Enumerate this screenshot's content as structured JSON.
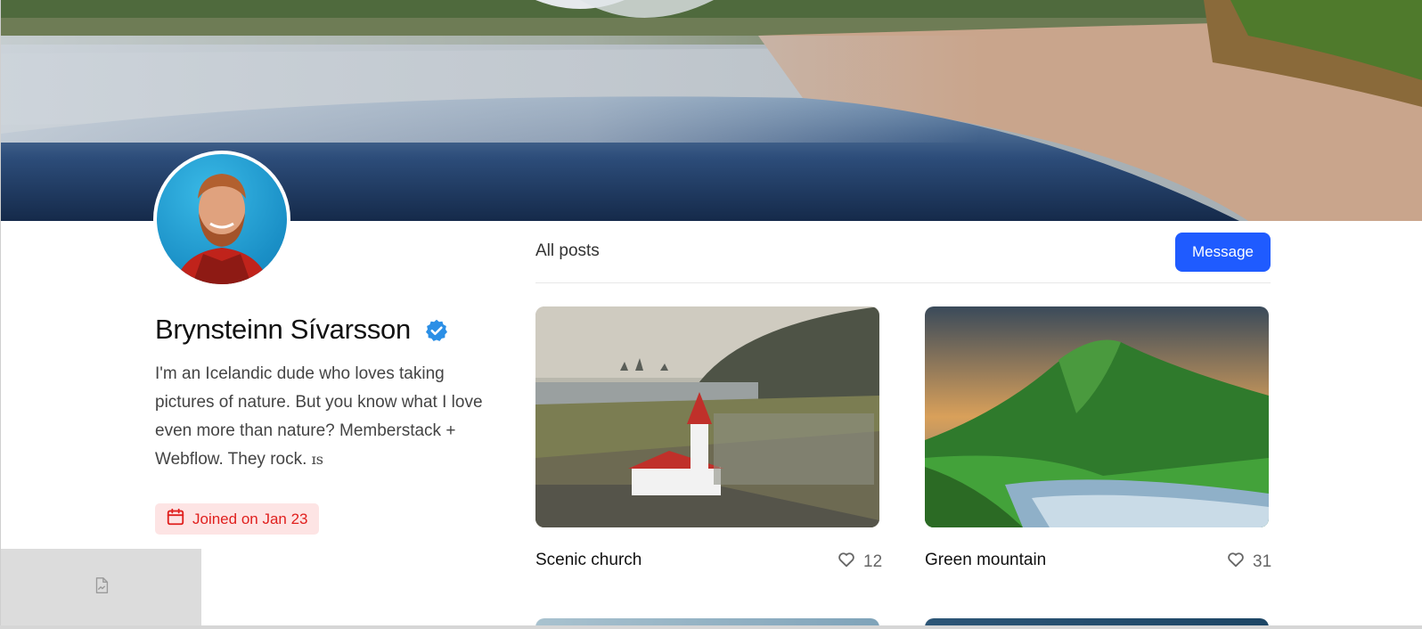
{
  "profile": {
    "name": "Brynsteinn Sívarsson",
    "bio": "I'm an Icelandic dude who loves taking pictures of nature. But you know what I love even more than nature? Memberstack + Webflow. They rock. ",
    "bio_emoji": "ɪs",
    "joined_label": "Joined on Jan 23",
    "verified": true
  },
  "posts": {
    "title": "All posts",
    "message_label": "Message",
    "items": [
      {
        "title": "Scenic church",
        "likes": "12"
      },
      {
        "title": "Green mountain",
        "likes": "31"
      }
    ]
  },
  "colors": {
    "accent": "#1f5bff",
    "verified_badge": "#2b8fe6",
    "joined_bg": "#fde4e4",
    "joined_text": "#e0201e"
  },
  "icons": {
    "verified": "verified-badge-icon",
    "calendar": "calendar-icon",
    "like": "heart-icon",
    "broken_image": "broken-image-icon"
  }
}
